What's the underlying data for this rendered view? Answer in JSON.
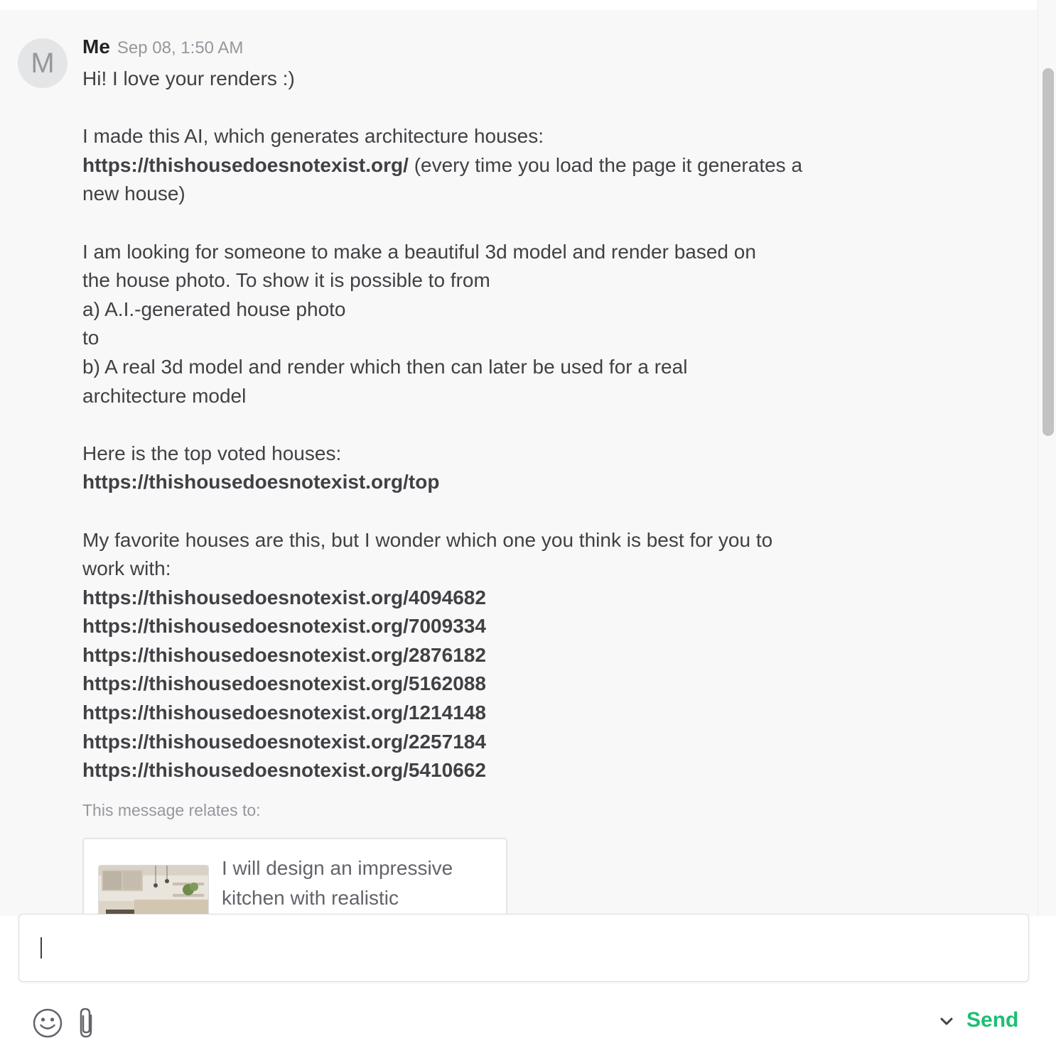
{
  "message": {
    "avatar_initial": "M",
    "sender": "Me",
    "timestamp": "Sep 08, 1:50 AM",
    "greeting": "Hi! I love your renders :)",
    "intro": "I made this AI, which generates architecture houses:",
    "main_link": "https://thishousedoesnotexist.org/",
    "main_link_suffix": " (every time you load the page it generates a",
    "main_link_cont": "new house)",
    "para2": [
      "I am looking for someone to make a beautiful 3d model and render based on",
      "the house photo. To show it is possible to from",
      "a) A.I.-generated house photo",
      "to",
      "b) A real 3d model and render which then can later be used for a real",
      "architecture model"
    ],
    "top_intro": "Here is the top voted houses:",
    "top_link": "https://thishousedoesnotexist.org/top",
    "favorites_intro": [
      "My favorite houses are this, but I wonder which one you think is best for you to",
      "work with:"
    ],
    "favorite_links": [
      "https://thishousedoesnotexist.org/4094682",
      "https://thishousedoesnotexist.org/7009334",
      "https://thishousedoesnotexist.org/2876182",
      "https://thishousedoesnotexist.org/5162088",
      "https://thishousedoesnotexist.org/1214148",
      "https://thishousedoesnotexist.org/2257184",
      "https://thishousedoesnotexist.org/5410662"
    ],
    "relates_label": "This message relates to:",
    "gig_title": "I will design an impressive kitchen with realistic"
  },
  "composer": {
    "value": "",
    "placeholder": "",
    "send_label": "Send",
    "emoji_icon": "emoji-icon",
    "attach_icon": "paperclip-icon",
    "chevron_icon": "chevron-down-icon"
  },
  "colors": {
    "accent": "#1dbf73",
    "text": "#404145",
    "muted": "#95979d",
    "thread_bg": "#f8f8f8"
  }
}
